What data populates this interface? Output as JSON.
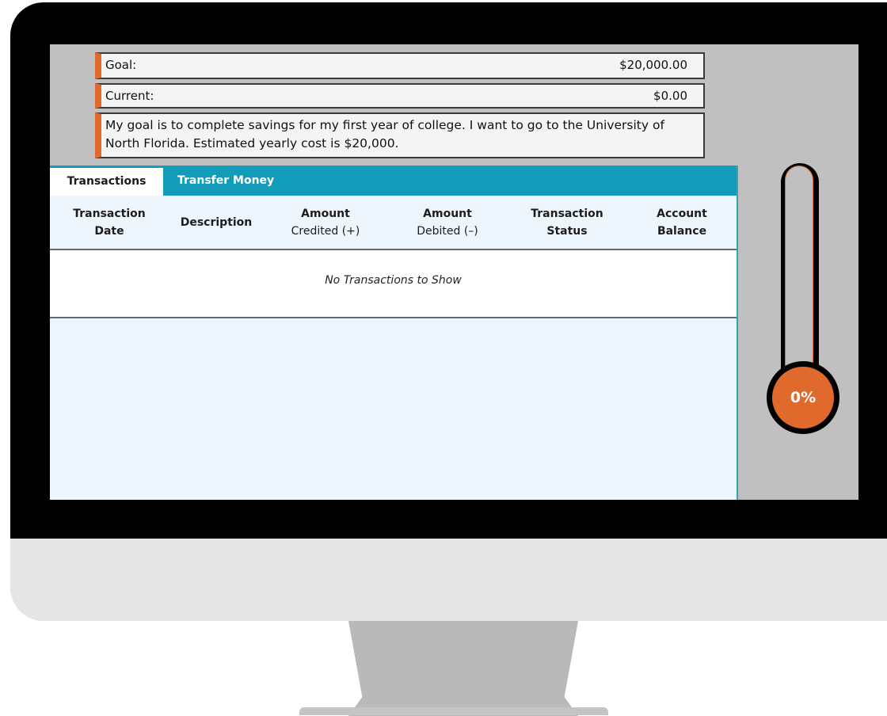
{
  "goal": {
    "label": "Goal:",
    "value": "$20,000.00"
  },
  "current": {
    "label": "Current:",
    "value": "$0.00"
  },
  "description": "My goal is to complete savings for my first year of college. I want to go to the University of North Florida. Estimated yearly cost is $20,000.",
  "tabs": [
    {
      "label": "Transactions",
      "active": true
    },
    {
      "label": "Transfer Money",
      "active": false
    }
  ],
  "table": {
    "columns": [
      {
        "line1": "Transaction",
        "line2": "Date"
      },
      {
        "line1": "Description",
        "line2": ""
      },
      {
        "line1": "Amount",
        "line2": "Credited (+)"
      },
      {
        "line1": "Amount",
        "line2": "Debited (–)"
      },
      {
        "line1": "Transaction",
        "line2": "Status"
      },
      {
        "line1": "Account",
        "line2": "Balance"
      }
    ],
    "empty_message": "No Transactions to Show"
  },
  "progress": {
    "label": "0%",
    "fraction": 0
  },
  "colors": {
    "accent": "#e06a2c",
    "tab_bar": "#139cba",
    "panel_bg": "#eef6fd",
    "screen_bg": "#c0c0c0"
  }
}
